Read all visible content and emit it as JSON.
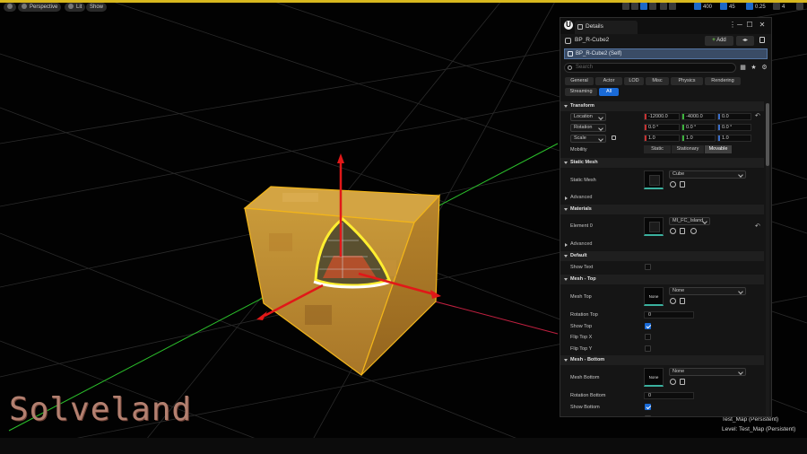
{
  "viewport": {
    "toolbar": {
      "perspective": "Perspective",
      "lit": "Lit",
      "show": "Show",
      "grid_snap": "400",
      "rotation_snap": "45",
      "scale_snap": "0.25",
      "camera_speed": "4"
    },
    "watermark": "Solveland",
    "level_info": [
      "Test_Map (Persistent)",
      "Level: Test_Map (Persistent)"
    ],
    "axis_colors": {
      "x": "#d42020",
      "y": "#2bbf2b",
      "z": "#d42020"
    },
    "cube_color": "#c7922f"
  },
  "details": {
    "tab_title": "Details",
    "win_controls": [
      "⋮",
      "─",
      "☐",
      "✕"
    ],
    "actor_name": "BP_R-Cube2",
    "add_label": "Add",
    "self_label": "BP_R-Cube2 (Self)",
    "search_placeholder": "Search",
    "filters": [
      "General",
      "Actor",
      "LOD",
      "Misc",
      "Physics",
      "Rendering",
      "Streaming",
      "All"
    ],
    "active_filter": "All",
    "sections": {
      "transform": {
        "title": "Transform",
        "location_label": "Location",
        "location": [
          "-12000.0",
          "-4000.0",
          "0.0"
        ],
        "rotation_label": "Rotation",
        "rotation": [
          "0.0 °",
          "0.0 °",
          "0.0 °"
        ],
        "scale_label": "Scale",
        "scale": [
          "1.0",
          "1.0",
          "1.0"
        ],
        "mobility_label": "Mobility",
        "mobility": [
          "Static",
          "Stationary",
          "Movable"
        ],
        "mobility_selected": "Movable"
      },
      "static_mesh": {
        "title": "Static Mesh",
        "label": "Static Mesh",
        "value": "Cube",
        "advanced": "Advanced"
      },
      "materials": {
        "title": "Materials",
        "label": "Element 0",
        "value": "MI_FC_Island",
        "advanced": "Advanced"
      },
      "default": {
        "title": "Default",
        "show_text_label": "Show Text",
        "show_text": false
      },
      "mesh_top": {
        "title": "Mesh - Top",
        "mesh_label": "Mesh Top",
        "thumb": "None",
        "value": "None",
        "rotation_label": "Rotation Top",
        "rotation": "0",
        "show_label": "Show Top",
        "show": true,
        "flip_x_label": "Flip Top X",
        "flip_x": false,
        "flip_y_label": "Flip Top Y",
        "flip_y": false
      },
      "mesh_bottom": {
        "title": "Mesh - Bottom",
        "mesh_label": "Mesh Bottom",
        "thumb": "None",
        "value": "None",
        "rotation_label": "Rotation Bottom",
        "rotation": "0",
        "show_label": "Show Bottom",
        "show": true
      }
    }
  }
}
